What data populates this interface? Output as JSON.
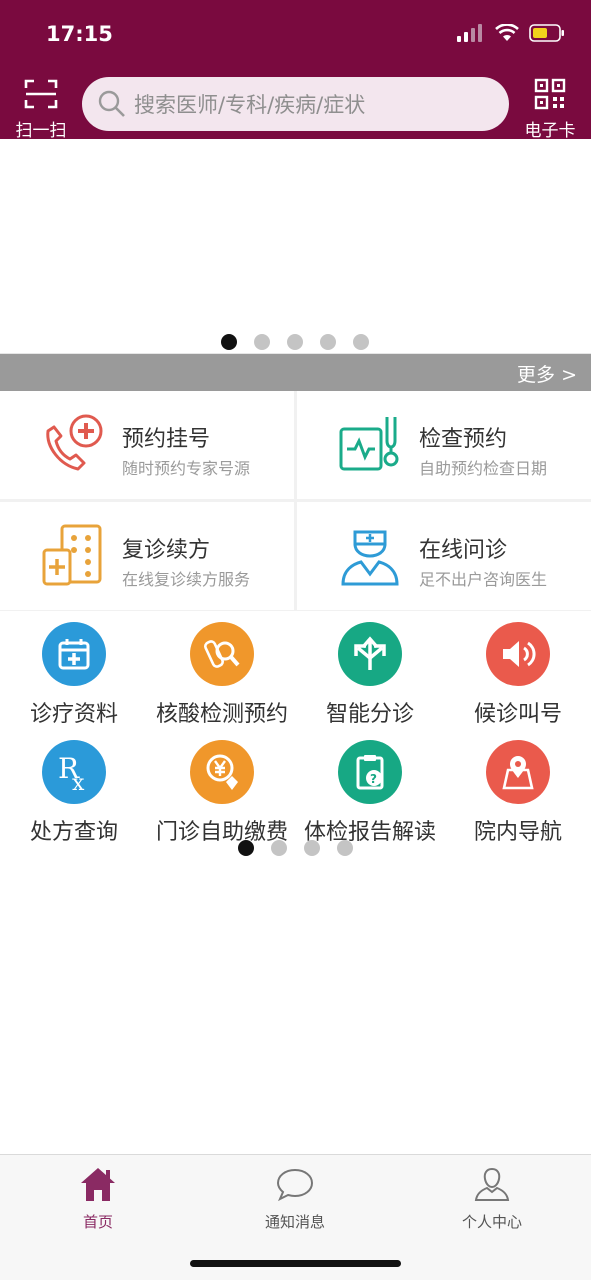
{
  "status_bar": {
    "time": "17:15"
  },
  "header": {
    "scan_label": "扫一扫",
    "search_placeholder": "搜索医师/专科/疾病/症状",
    "card_label": "电子卡"
  },
  "banner": {
    "more_label": "更多 >",
    "page_count": 5,
    "active_page": 1
  },
  "services": [
    {
      "title": "预约挂号",
      "subtitle": "随时预约专家号源",
      "icon": "phone-plus-icon",
      "color": "#e05a4f"
    },
    {
      "title": "检查预约",
      "subtitle": "自助预约检查日期",
      "icon": "stethoscope-monitor-icon",
      "color": "#1aab8a"
    },
    {
      "title": "复诊续方",
      "subtitle": "在线复诊续方服务",
      "icon": "medicine-box-icon",
      "color": "#e8a33a"
    },
    {
      "title": "在线问诊",
      "subtitle": "足不出户咨询医生",
      "icon": "doctor-icon",
      "color": "#2e9bd6"
    }
  ],
  "functions": [
    {
      "label": "诊疗资料",
      "icon": "calendar-plus-icon",
      "color": "#2b9ad9"
    },
    {
      "label": "核酸检测预约",
      "icon": "test-search-icon",
      "color": "#f0972b"
    },
    {
      "label": "智能分诊",
      "icon": "arrows-split-icon",
      "color": "#17a884"
    },
    {
      "label": "候诊叫号",
      "icon": "speaker-icon",
      "color": "#ea5a4c"
    },
    {
      "label": "处方查询",
      "icon": "rx-icon",
      "color": "#2b9ad9"
    },
    {
      "label": "门诊自助缴费",
      "icon": "yuan-coin-icon",
      "color": "#f0972b"
    },
    {
      "label": "体检报告解读",
      "icon": "clipboard-question-icon",
      "color": "#17a884"
    },
    {
      "label": "院内导航",
      "icon": "map-pin-icon",
      "color": "#ea5a4c"
    }
  ],
  "function_pager": {
    "page_count": 4,
    "active_page": 1
  },
  "tabbar": {
    "tabs": [
      {
        "label": "首页",
        "icon": "home-icon",
        "active": true
      },
      {
        "label": "通知消息",
        "icon": "chat-bubble-icon",
        "active": false
      },
      {
        "label": "个人中心",
        "icon": "user-icon",
        "active": false
      }
    ]
  },
  "colors": {
    "brand": "#7a0a3f",
    "active_tab": "#8a2a63"
  }
}
